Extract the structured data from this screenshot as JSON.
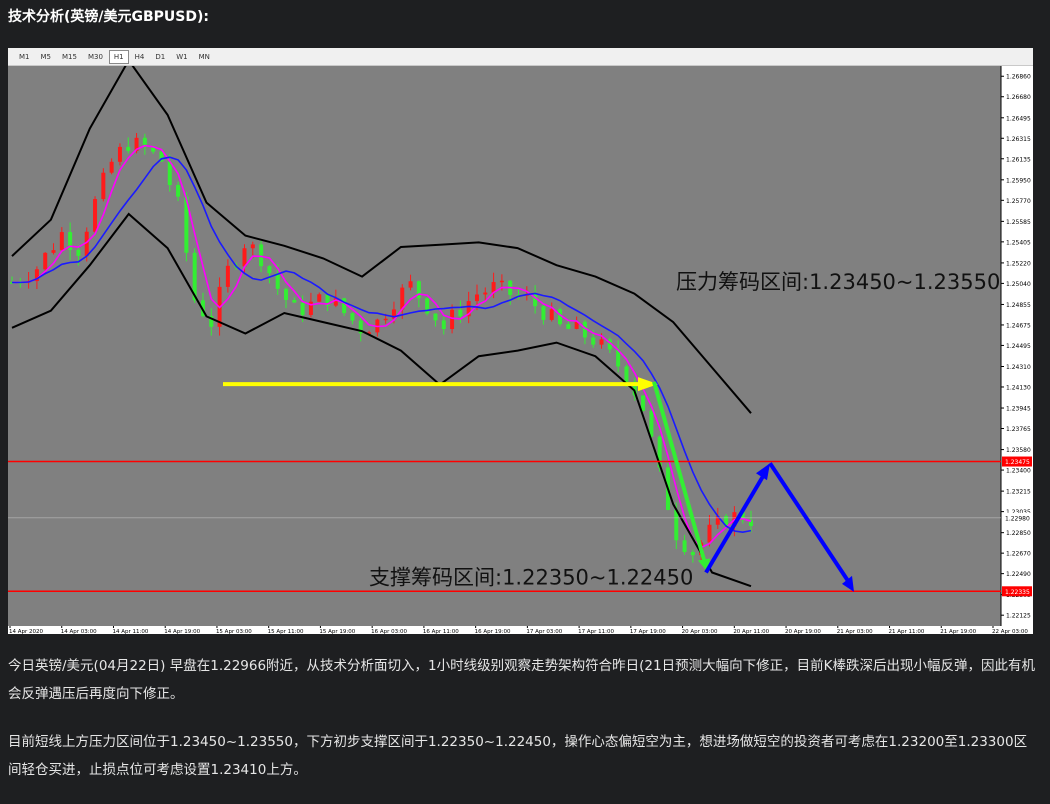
{
  "header": {
    "title": "技术分析(英镑/美元GBPUSD):"
  },
  "toolbar": {
    "timeframes": [
      "M1",
      "M5",
      "M15",
      "M30",
      "H1",
      "H4",
      "D1",
      "W1",
      "MN"
    ],
    "active": "H1"
  },
  "chart_data": {
    "type": "candlestick",
    "symbol": "GBPUSD",
    "timeframe": "H1",
    "y_ticks": [
      "1.26860",
      "1.26680",
      "1.26495",
      "1.26315",
      "1.26135",
      "1.25950",
      "1.25770",
      "1.25585",
      "1.25405",
      "1.25220",
      "1.25040",
      "1.24855",
      "1.24675",
      "1.24495",
      "1.24310",
      "1.24130",
      "1.23945",
      "1.23765",
      "1.23580",
      "1.23400",
      "1.23215",
      "1.23035",
      "1.22850",
      "1.22670",
      "1.22490",
      "1.22305",
      "1.22125"
    ],
    "ylim": [
      1.2203,
      1.2695
    ],
    "x_ticks": [
      "14 Apr 2020",
      "14 Apr 03:00",
      "14 Apr 11:00",
      "14 Apr 19:00",
      "15 Apr 03:00",
      "15 Apr 11:00",
      "15 Apr 19:00",
      "16 Apr 03:00",
      "16 Apr 11:00",
      "16 Apr 19:00",
      "17 Apr 03:00",
      "17 Apr 11:00",
      "17 Apr 19:00",
      "20 Apr 03:00",
      "20 Apr 11:00",
      "20 Apr 19:00",
      "21 Apr 03:00",
      "21 Apr 11:00",
      "21 Apr 19:00",
      "22 Apr 03:00"
    ],
    "price_series": [
      {
        "x": 0,
        "y": 1.2505
      },
      {
        "x": 3,
        "y": 1.2518
      },
      {
        "x": 6,
        "y": 1.2548
      },
      {
        "x": 8,
        "y": 1.2535
      },
      {
        "x": 10,
        "y": 1.2575
      },
      {
        "x": 12,
        "y": 1.261
      },
      {
        "x": 14,
        "y": 1.2628
      },
      {
        "x": 16,
        "y": 1.2622
      },
      {
        "x": 18,
        "y": 1.2612
      },
      {
        "x": 20,
        "y": 1.2572
      },
      {
        "x": 22,
        "y": 1.249
      },
      {
        "x": 24,
        "y": 1.247
      },
      {
        "x": 26,
        "y": 1.2515
      },
      {
        "x": 28,
        "y": 1.254
      },
      {
        "x": 30,
        "y": 1.2528
      },
      {
        "x": 32,
        "y": 1.25
      },
      {
        "x": 34,
        "y": 1.248
      },
      {
        "x": 36,
        "y": 1.2485
      },
      {
        "x": 38,
        "y": 1.2492
      },
      {
        "x": 40,
        "y": 1.2478
      },
      {
        "x": 42,
        "y": 1.2465
      },
      {
        "x": 44,
        "y": 1.247
      },
      {
        "x": 46,
        "y": 1.249
      },
      {
        "x": 48,
        "y": 1.2502
      },
      {
        "x": 50,
        "y": 1.2485
      },
      {
        "x": 52,
        "y": 1.2465
      },
      {
        "x": 54,
        "y": 1.2482
      },
      {
        "x": 56,
        "y": 1.2495
      },
      {
        "x": 58,
        "y": 1.25
      },
      {
        "x": 60,
        "y": 1.2495
      },
      {
        "x": 62,
        "y": 1.249
      },
      {
        "x": 64,
        "y": 1.248
      },
      {
        "x": 66,
        "y": 1.2465
      },
      {
        "x": 68,
        "y": 1.2462
      },
      {
        "x": 70,
        "y": 1.2455
      },
      {
        "x": 72,
        "y": 1.244
      },
      {
        "x": 74,
        "y": 1.2425
      },
      {
        "x": 76,
        "y": 1.2395
      },
      {
        "x": 78,
        "y": 1.2335
      },
      {
        "x": 80,
        "y": 1.2285
      },
      {
        "x": 82,
        "y": 1.2268
      },
      {
        "x": 84,
        "y": 1.2285
      },
      {
        "x": 86,
        "y": 1.2298
      },
      {
        "x": 88,
        "y": 1.23
      },
      {
        "x": 89,
        "y": 1.2297
      }
    ],
    "bands": {
      "upper": [
        1.2528,
        1.256,
        1.264,
        1.27,
        1.2652,
        1.2575,
        1.2546,
        1.2537,
        1.2526,
        1.251,
        1.2536,
        1.2538,
        1.254,
        1.2535,
        1.252,
        1.251,
        1.2495,
        1.247,
        1.243,
        1.239
      ],
      "lower": [
        1.2465,
        1.248,
        1.252,
        1.2565,
        1.2535,
        1.2475,
        1.246,
        1.2478,
        1.247,
        1.2462,
        1.2445,
        1.2415,
        1.244,
        1.2445,
        1.2452,
        1.244,
        1.241,
        1.231,
        1.225,
        1.2238
      ]
    },
    "current_price": "1.22980",
    "annotations": [
      {
        "text": "压力筹码区间:1.23450~1.23550",
        "price": 1.2348
      },
      {
        "text": "支撑筹码区间:1.22350~1.22450",
        "price": 1.2236
      }
    ],
    "support_line": 1.24155,
    "colors": {
      "bg": "#808080",
      "bull": "#ff1a1a",
      "bear": "#33ee33",
      "ma_fast": "#ff00ff",
      "ma_slow": "#1a1aff",
      "band": "#000000",
      "hline": "#ff0000",
      "arrow_blue": "#0000ff",
      "arrow_yellow": "#ffff00",
      "arrow_green": "#33ee33"
    }
  },
  "body": {
    "p1": "今日英镑/美元(04月22日) 早盘在1.22966附近，从技术分析面切入，1小时线级别观察走势架构符合昨日(21日预测大幅向下修正，目前K棒跌深后出现小幅反弹，因此有机会反弹遇压后再度向下修正。",
    "p2": "目前短线上方压力区间位于1.23450~1.23550，下方初步支撑区间于1.22350~1.22450，操作心态偏短空为主，想进场做短空的投资者可考虑在1.23200至1.23300区间轻仓买进，止损点位可考虑设置1.23410上方。"
  }
}
